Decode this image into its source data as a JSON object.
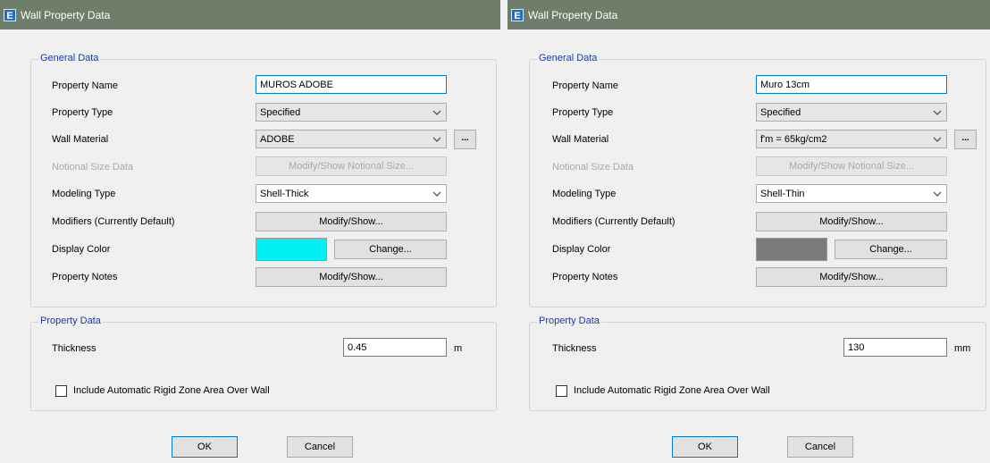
{
  "dialogs": [
    {
      "title": "Wall Property Data",
      "app_icon": "E",
      "general_data": {
        "group_label": "General Data",
        "property_name": {
          "label": "Property Name",
          "value": "MUROS ADOBE"
        },
        "property_type": {
          "label": "Property Type",
          "value": "Specified"
        },
        "wall_material": {
          "label": "Wall Material",
          "value": "ADOBE",
          "browse_label": "..."
        },
        "notional_size": {
          "label": "Notional Size Data",
          "button_label": "Modify/Show Notional Size..."
        },
        "modeling_type": {
          "label": "Modeling Type",
          "value": "Shell-Thick"
        },
        "modifiers": {
          "label": "Modifiers (Currently Default)",
          "button_label": "Modify/Show..."
        },
        "display_color": {
          "label": "Display Color",
          "color": "#00f0f4",
          "button_label": "Change..."
        },
        "property_notes": {
          "label": "Property Notes",
          "button_label": "Modify/Show..."
        }
      },
      "property_data": {
        "group_label": "Property Data",
        "thickness": {
          "label": "Thickness",
          "value": "0.45",
          "unit": "m"
        },
        "rigid_zone": {
          "label": "Include Automatic Rigid Zone Area Over Wall",
          "checked": false
        }
      },
      "buttons": {
        "ok": "OK",
        "cancel": "Cancel"
      }
    },
    {
      "title": "Wall Property Data",
      "app_icon": "E",
      "general_data": {
        "group_label": "General Data",
        "property_name": {
          "label": "Property Name",
          "value": "Muro 13cm"
        },
        "property_type": {
          "label": "Property Type",
          "value": "Specified"
        },
        "wall_material": {
          "label": "Wall Material",
          "value": "f'm = 65kg/cm2",
          "browse_label": "..."
        },
        "notional_size": {
          "label": "Notional Size Data",
          "button_label": "Modify/Show Notional Size..."
        },
        "modeling_type": {
          "label": "Modeling Type",
          "value": "Shell-Thin"
        },
        "modifiers": {
          "label": "Modifiers (Currently Default)",
          "button_label": "Modify/Show..."
        },
        "display_color": {
          "label": "Display Color",
          "color": "#7a7a7a",
          "button_label": "Change..."
        },
        "property_notes": {
          "label": "Property Notes",
          "button_label": "Modify/Show..."
        }
      },
      "property_data": {
        "group_label": "Property Data",
        "thickness": {
          "label": "Thickness",
          "value": "130",
          "unit": "mm"
        },
        "rigid_zone": {
          "label": "Include Automatic Rigid Zone Area Over Wall",
          "checked": false
        }
      },
      "buttons": {
        "ok": "OK",
        "cancel": "Cancel"
      }
    }
  ],
  "colors": {
    "titlebar": "#6e7e6a",
    "group_label": "#1a3aa6",
    "focus_border": "#0078d7"
  }
}
